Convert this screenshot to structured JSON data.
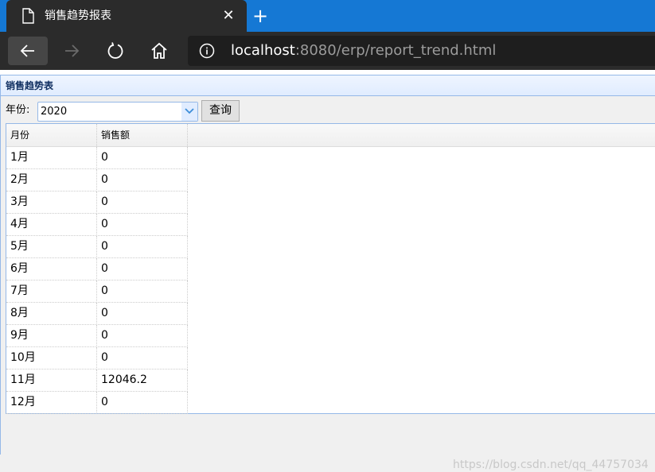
{
  "browser": {
    "tab_title": "销售趋势报表",
    "url_host": "localhost",
    "url_rest": ":8080/erp/report_trend.html"
  },
  "panel": {
    "title": "销售趋势表",
    "year_label": "年份:",
    "year_value": "2020",
    "query_label": "查询"
  },
  "grid": {
    "columns": [
      "月份",
      "销售额"
    ],
    "rows": [
      {
        "month": "1月",
        "amount": "0"
      },
      {
        "month": "2月",
        "amount": "0"
      },
      {
        "month": "3月",
        "amount": "0"
      },
      {
        "month": "4月",
        "amount": "0"
      },
      {
        "month": "5月",
        "amount": "0"
      },
      {
        "month": "6月",
        "amount": "0"
      },
      {
        "month": "7月",
        "amount": "0"
      },
      {
        "month": "8月",
        "amount": "0"
      },
      {
        "month": "9月",
        "amount": "0"
      },
      {
        "month": "10月",
        "amount": "0"
      },
      {
        "month": "11月",
        "amount": "12046.2"
      },
      {
        "month": "12月",
        "amount": "0"
      }
    ]
  },
  "watermark": "https://blog.csdn.net/qq_44757034",
  "colors": {
    "tabbar": "#1578d4",
    "toolbar": "#2b2b2b",
    "panel_border": "#95b8e7",
    "panel_title": "#0e2d5f"
  }
}
